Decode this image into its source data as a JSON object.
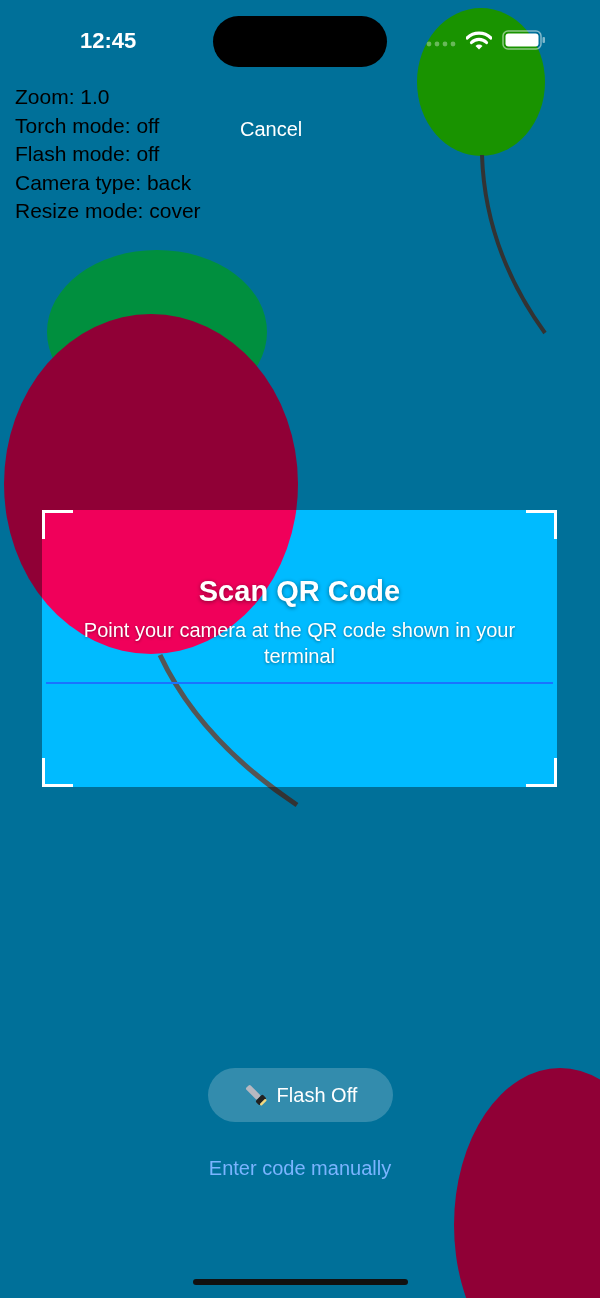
{
  "status_bar": {
    "time": "12:45"
  },
  "debug_info": [
    "Zoom: 1.0",
    "Torch mode: off",
    "Flash mode: off",
    "Camera type: back",
    "Resize mode: cover"
  ],
  "cancel_button": {
    "label": "Cancel"
  },
  "scanner": {
    "title": "Scan QR Code",
    "instructions": "Point your camera at the QR code shown in your terminal"
  },
  "flash_button": {
    "label": "Flash Off"
  },
  "manual_entry_link": {
    "label": "Enter code manually"
  }
}
